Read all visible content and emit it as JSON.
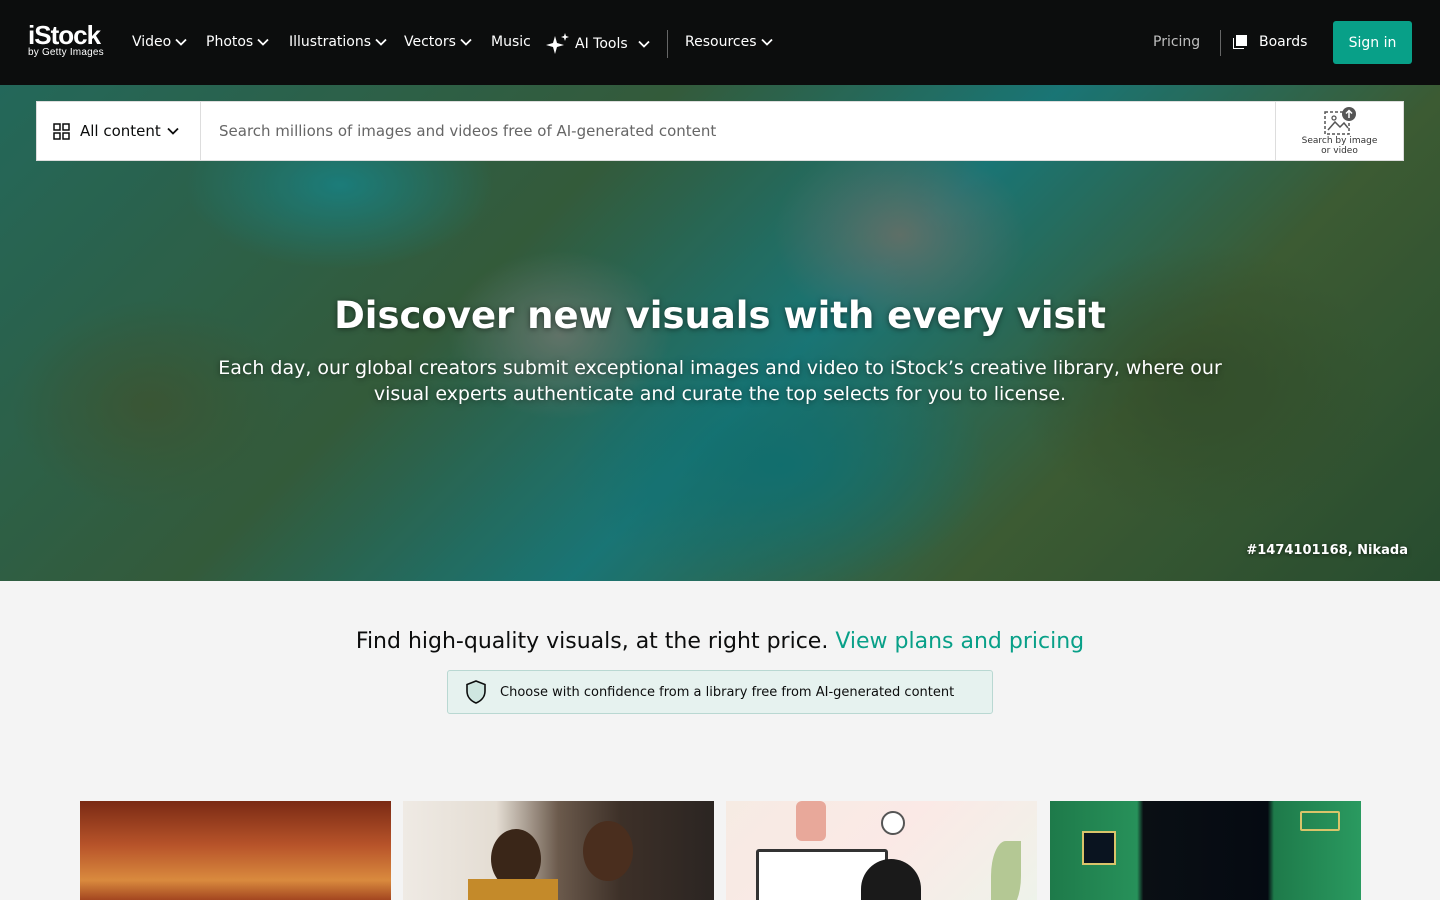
{
  "logo": {
    "main": "iStock",
    "sub": "by Getty Images"
  },
  "nav": {
    "items": [
      {
        "label": "Video"
      },
      {
        "label": "Photos"
      },
      {
        "label": "Illustrations"
      },
      {
        "label": "Vectors"
      },
      {
        "label": "Music"
      },
      {
        "label": "AI Tools"
      },
      {
        "label": "Resources"
      }
    ],
    "pricing": "Pricing",
    "boards": "Boards",
    "signin": "Sign in"
  },
  "search": {
    "content_type": "All content",
    "placeholder": "Search millions of images and videos free of AI-generated content",
    "image_search_label_line1": "Search by image",
    "image_search_label_line2": "or video"
  },
  "hero": {
    "title": "Discover new visuals with every visit",
    "subtitle": "Each day, our global creators submit exceptional images and video to iStock’s creative library, where our visual experts authenticate and curate the top selects for you to license.",
    "credit": "#1474101168, Nikada"
  },
  "pricing_line": {
    "text": "Find high-quality visuals, at the right price.",
    "link": "View plans and pricing"
  },
  "confidence_banner": {
    "text": "Choose with confidence from a library free from AI-generated content"
  },
  "colors": {
    "accent": "#08a088",
    "nav_bg": "#0c0d0d",
    "page_bg": "#f4f4f4",
    "banner_bg": "#e6f2ef"
  },
  "icons": [
    "sparkle-icon",
    "grid-icon",
    "chevron-down-icon",
    "board-icon",
    "image-search-icon",
    "shield-icon"
  ]
}
